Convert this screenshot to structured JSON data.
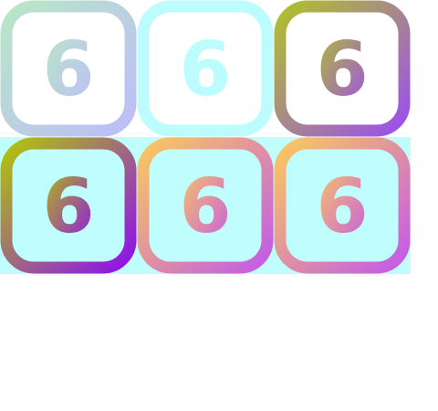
{
  "background_color": "#ffffff",
  "rows": [
    {
      "background": "#ffffff",
      "tiles": [
        {
          "label": "6",
          "fill": "#ffffff",
          "gradient": [
            "#b9e6c6",
            "#bdbdf9"
          ],
          "text_opacity": 1
        },
        {
          "label": "6",
          "fill": "#ffffff",
          "gradient": [
            "#bdfcfd",
            "#bdfcfd"
          ],
          "text_opacity": 1
        },
        {
          "label": "6",
          "fill": "#ffffff",
          "gradient": [
            "#b1c02c",
            "#9c4fee"
          ],
          "text_opacity": 1
        }
      ]
    },
    {
      "background": "#c0fdfd",
      "tiles": [
        {
          "label": "6",
          "fill": "#c0fdfd",
          "gradient": [
            "#b1c40a",
            "#8f0ff0"
          ],
          "text_opacity": 1
        },
        {
          "label": "6",
          "fill": "#c0fdfd",
          "gradient": [
            "#fbc75f",
            "#c35ae8"
          ],
          "text_opacity": 1
        },
        {
          "label": "6",
          "fill": "#c0fdfd",
          "gradient": [
            "#fbc75f",
            "#c35ae8"
          ],
          "text_opacity": 1
        }
      ]
    }
  ]
}
